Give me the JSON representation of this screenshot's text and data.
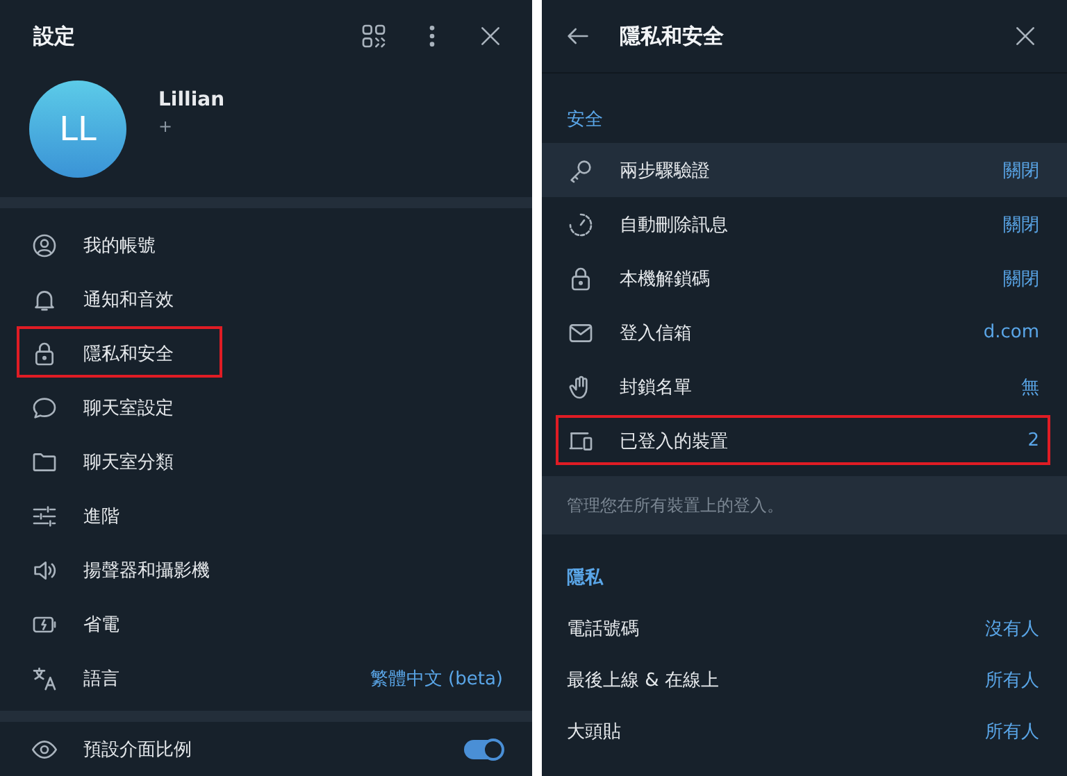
{
  "settings_panel": {
    "title": "設定",
    "profile": {
      "initials": "LL",
      "name": "Lillian",
      "phone": "+"
    },
    "items": [
      {
        "kind": "account",
        "label": "我的帳號",
        "highlighted": false
      },
      {
        "kind": "bell",
        "label": "通知和音效",
        "highlighted": false
      },
      {
        "kind": "lock",
        "label": "隱私和安全",
        "highlighted": true
      },
      {
        "kind": "chat",
        "label": "聊天室設定",
        "highlighted": false
      },
      {
        "kind": "folder",
        "label": "聊天室分類",
        "highlighted": false
      },
      {
        "kind": "sliders",
        "label": "進階",
        "highlighted": false
      },
      {
        "kind": "speaker",
        "label": "揚聲器和攝影機",
        "highlighted": false
      },
      {
        "kind": "battery",
        "label": "省電",
        "highlighted": false
      },
      {
        "kind": "translate",
        "label": "語言",
        "value": "繁體中文 (beta)",
        "highlighted": false
      }
    ],
    "scale_row": {
      "label": "預設介面比例",
      "on": true
    }
  },
  "privacy_panel": {
    "title": "隱私和安全",
    "security_header": "安全",
    "security_items": [
      {
        "kind": "key",
        "label": "兩步驟驗證",
        "value": "關閉",
        "hovered": true,
        "highlighted": false
      },
      {
        "kind": "timer",
        "label": "自動刪除訊息",
        "value": "關閉",
        "hovered": false,
        "highlighted": false
      },
      {
        "kind": "lock",
        "label": "本機解鎖碼",
        "value": "關閉",
        "hovered": false,
        "highlighted": false
      },
      {
        "kind": "mail",
        "label": "登入信箱",
        "value": "d.com",
        "hovered": false,
        "highlighted": false
      },
      {
        "kind": "hand",
        "label": "封鎖名單",
        "value": "無",
        "hovered": false,
        "highlighted": false
      },
      {
        "kind": "devices",
        "label": "已登入的裝置",
        "value": "2",
        "hovered": false,
        "highlighted": true
      }
    ],
    "security_note": "管理您在所有裝置上的登入。",
    "privacy_header": "隱私",
    "privacy_items": [
      {
        "label": "電話號碼",
        "value": "沒有人"
      },
      {
        "label": "最後上線 & 在線上",
        "value": "所有人"
      },
      {
        "label": "大頭貼",
        "value": "所有人"
      }
    ]
  }
}
